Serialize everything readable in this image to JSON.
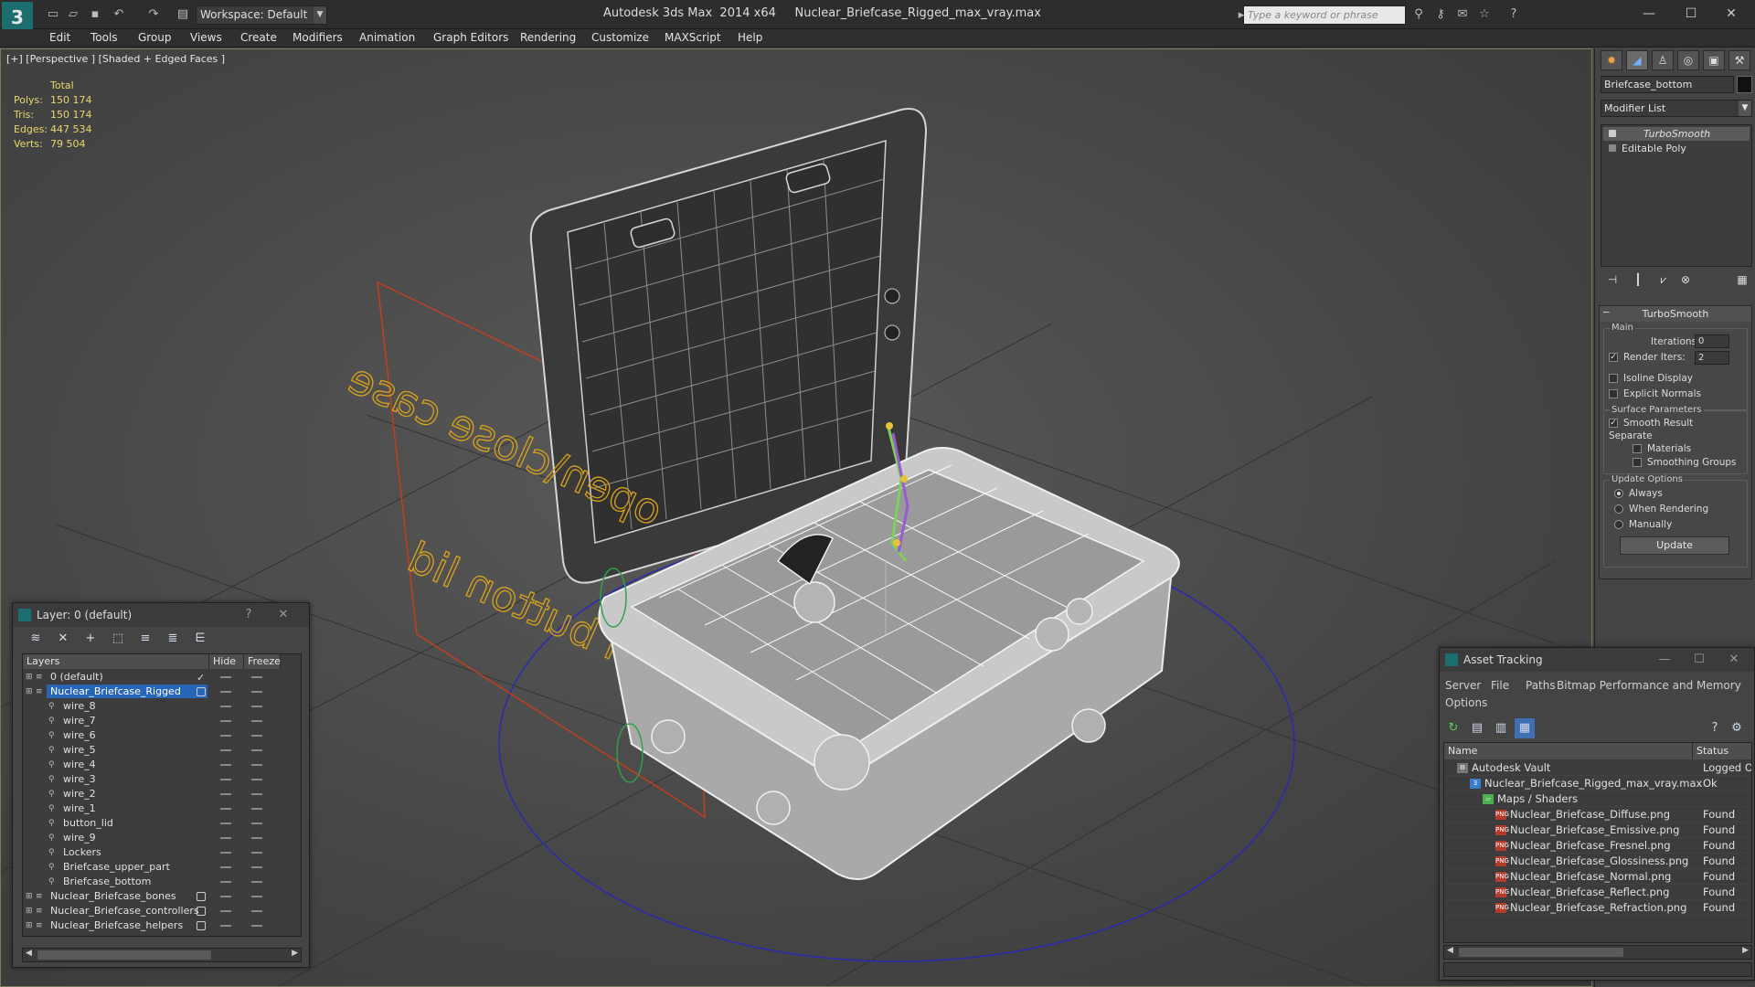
{
  "app": {
    "logo": "3ds-max-logo-icon",
    "title": "Autodesk 3ds Max  2014 x64     Nuclear_Briefcase_Rigged_max_vray.max",
    "workspace": "Workspace: Default",
    "search_placeholder": "Type a keyword or phrase"
  },
  "menu": [
    "Edit",
    "Tools",
    "Group",
    "Views",
    "Create",
    "Modifiers",
    "Animation",
    "Graph Editors",
    "Rendering",
    "Customize",
    "MAXScript",
    "Help"
  ],
  "viewport": {
    "label": "[+] [Perspective ] [Shaded + Edged Faces ]",
    "stats": {
      "header": "Total",
      "rows": [
        {
          "label": "Polys:",
          "value": "150 174"
        },
        {
          "label": "Tris:",
          "value": "150 174"
        },
        {
          "label": "Edges:",
          "value": "447 534"
        },
        {
          "label": "Verts:",
          "value": "79 504"
        }
      ]
    },
    "scene_text": {
      "open_close": "open\\close case",
      "open_button": "open button lid"
    },
    "colors": {
      "wire": "#d6d6d6",
      "helper_text": "#d9a21b",
      "plane": "#c0401f",
      "circle": "#2a2ab0"
    }
  },
  "command_panel": {
    "object_name": "Briefcase_bottom",
    "modifier_list": "Modifier List",
    "stack": [
      "TurboSmooth",
      "Editable Poly"
    ],
    "turbosmooth": {
      "title": "TurboSmooth",
      "main": "Main",
      "iterations_label": "Iterations:",
      "iterations": "0",
      "render_iters_label": "Render Iters:",
      "render_iters": "2",
      "isoline": "Isoline Display",
      "explicit_normals": "Explicit Normals",
      "surface_params": "Surface Parameters",
      "smooth_result": "Smooth Result",
      "separate": "Separate",
      "materials": "Materials",
      "smoothing_groups": "Smoothing Groups",
      "update_options": "Update Options",
      "always": "Always",
      "when_rendering": "When Rendering",
      "manually": "Manually",
      "update_btn": "Update"
    }
  },
  "layer_panel": {
    "title": "Layer: 0 (default)",
    "help": "?",
    "close": "✕",
    "columns": [
      "Layers",
      "Hide",
      "Freeze"
    ],
    "rows": [
      {
        "name": "0 (default)",
        "indent": 1,
        "type": "layer",
        "checked": true
      },
      {
        "name": "Nuclear_Briefcase_Rigged",
        "indent": 1,
        "type": "layer",
        "selected": true,
        "box": true
      },
      {
        "name": "wire_8",
        "indent": 2,
        "type": "obj"
      },
      {
        "name": "wire_7",
        "indent": 2,
        "type": "obj"
      },
      {
        "name": "wire_6",
        "indent": 2,
        "type": "obj"
      },
      {
        "name": "wire_5",
        "indent": 2,
        "type": "obj"
      },
      {
        "name": "wire_4",
        "indent": 2,
        "type": "obj"
      },
      {
        "name": "wire_3",
        "indent": 2,
        "type": "obj"
      },
      {
        "name": "wire_2",
        "indent": 2,
        "type": "obj"
      },
      {
        "name": "wire_1",
        "indent": 2,
        "type": "obj"
      },
      {
        "name": "button_lid",
        "indent": 2,
        "type": "obj"
      },
      {
        "name": "wire_9",
        "indent": 2,
        "type": "obj"
      },
      {
        "name": "Lockers",
        "indent": 2,
        "type": "obj"
      },
      {
        "name": "Briefcase_upper_part",
        "indent": 2,
        "type": "obj"
      },
      {
        "name": "Briefcase_bottom",
        "indent": 2,
        "type": "obj"
      },
      {
        "name": "Nuclear_Briefcase_bones",
        "indent": 1,
        "type": "layer",
        "box": true
      },
      {
        "name": "Nuclear_Briefcase_controllers",
        "indent": 1,
        "type": "layer",
        "box": true
      },
      {
        "name": "Nuclear_Briefcase_helpers",
        "indent": 1,
        "type": "layer",
        "box": true
      }
    ]
  },
  "asset_panel": {
    "title": "Asset Tracking",
    "menu": [
      "Server",
      "File",
      "Paths",
      "Bitmap Performance and Memory",
      "Options"
    ],
    "columns": [
      "Name",
      "Status"
    ],
    "rows": [
      {
        "name": "Autodesk Vault",
        "status": "Logged Ou",
        "indent": 0,
        "icon": "vault"
      },
      {
        "name": "Nuclear_Briefcase_Rigged_max_vray.max",
        "status": "Ok",
        "indent": 1,
        "icon": "max"
      },
      {
        "name": "Maps / Shaders",
        "status": "",
        "indent": 2,
        "icon": "folder"
      },
      {
        "name": "Nuclear_Briefcase_Diffuse.png",
        "status": "Found",
        "indent": 3,
        "icon": "png"
      },
      {
        "name": "Nuclear_Briefcase_Emissive.png",
        "status": "Found",
        "indent": 3,
        "icon": "png"
      },
      {
        "name": "Nuclear_Briefcase_Fresnel.png",
        "status": "Found",
        "indent": 3,
        "icon": "png"
      },
      {
        "name": "Nuclear_Briefcase_Glossiness.png",
        "status": "Found",
        "indent": 3,
        "icon": "png"
      },
      {
        "name": "Nuclear_Briefcase_Normal.png",
        "status": "Found",
        "indent": 3,
        "icon": "png"
      },
      {
        "name": "Nuclear_Briefcase_Reflect.png",
        "status": "Found",
        "indent": 3,
        "icon": "png"
      },
      {
        "name": "Nuclear_Briefcase_Refraction.png",
        "status": "Found",
        "indent": 3,
        "icon": "png"
      }
    ]
  }
}
